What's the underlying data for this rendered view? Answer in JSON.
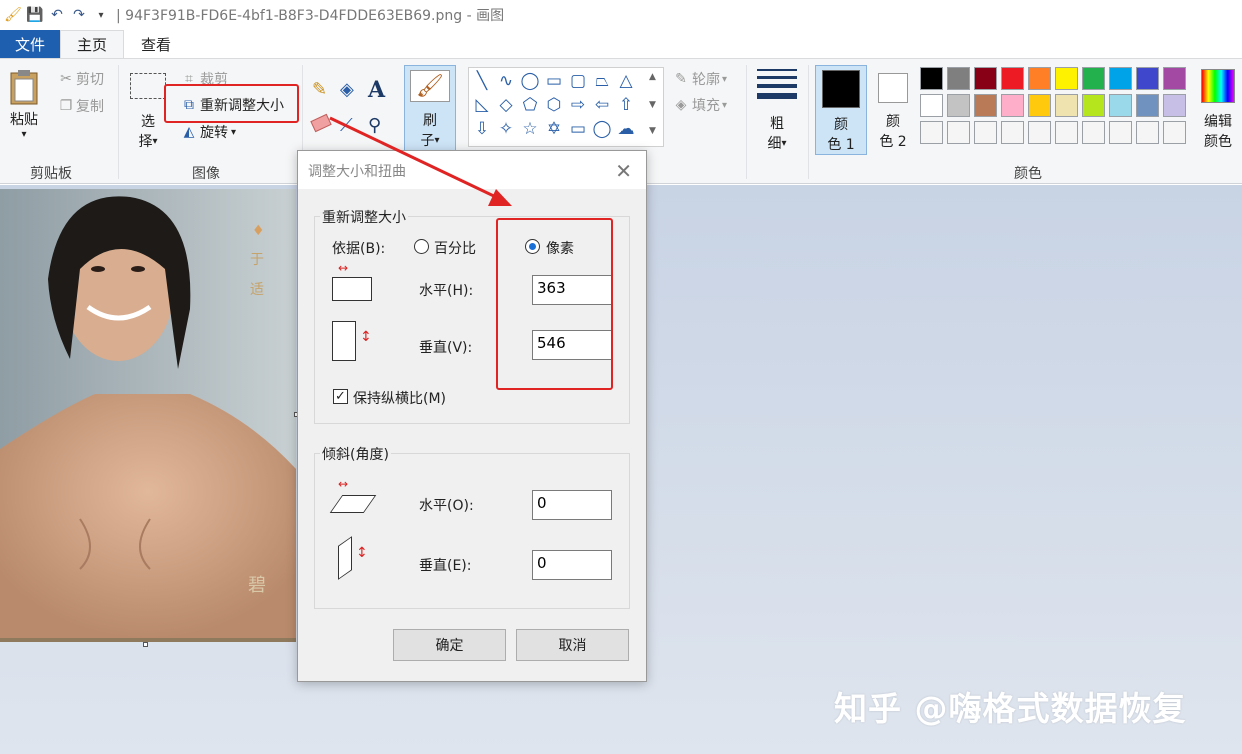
{
  "titlebar": {
    "title": "| 94F3F91B-FD6E-4bf1-B8F3-D4FDDE63EB69.png - 画图",
    "icons": [
      "paint-app-icon",
      "save-icon",
      "undo-icon",
      "redo-icon",
      "customize-dropdown-icon"
    ]
  },
  "tabs": {
    "file": "文件",
    "home": "主页",
    "view": "查看"
  },
  "ribbon": {
    "clipboard": {
      "paste": "粘贴",
      "cut": "剪切",
      "copy": "复制",
      "label": "剪贴板"
    },
    "image": {
      "select_1": "选",
      "select_2": "择",
      "crop": "裁剪",
      "resize": "重新调整大小",
      "rotate": "旋转",
      "label": "图像"
    },
    "tools": {
      "text_glyph": "A"
    },
    "brushes": {
      "label_1": "刷",
      "label_2": "子"
    },
    "shapes": {
      "outline": "轮廓",
      "fill": "填充"
    },
    "size": {
      "label_1": "粗",
      "label_2": "细"
    },
    "colors": {
      "color1_1": "颜",
      "color1_2": "色 1",
      "color2_1": "颜",
      "color2_2": "色 2",
      "edit_1": "编辑",
      "edit_2": "颜色",
      "label": "颜色",
      "row1": [
        "#000000",
        "#7f7f7f",
        "#880015",
        "#ed1c24",
        "#ff7f27",
        "#fff200",
        "#22b14c",
        "#00a2e8",
        "#3f48cc",
        "#a349a4"
      ],
      "row2": [
        "#ffffff",
        "#c3c3c3",
        "#b97a57",
        "#ffaec9",
        "#ffc90e",
        "#efe4b0",
        "#b5e61d",
        "#99d9ea",
        "#7092be",
        "#c8bfe7"
      ],
      "row3": [
        "#f5f5f5",
        "#f5f5f5",
        "#f5f5f5",
        "#f5f5f5",
        "#f5f5f5",
        "#f5f5f5",
        "#f5f5f5",
        "#f5f5f5",
        "#f5f5f5",
        "#f5f5f5"
      ]
    }
  },
  "photo": {
    "side_text_1": "于",
    "side_text_2": "适",
    "logo_text": "碧"
  },
  "dialog": {
    "title": "调整大小和扭曲",
    "resize_legend": "重新调整大小",
    "by_label": "依据(B):",
    "percent": "百分比",
    "pixels": "像素",
    "horizontal_label": "水平(H):",
    "horizontal_value": "363",
    "vertical_label": "垂直(V):",
    "vertical_value": "546",
    "keep_ratio": "保持纵横比(M)",
    "skew_legend": "倾斜(角度)",
    "skew_h_label": "水平(O):",
    "skew_h_value": "0",
    "skew_v_label": "垂直(E):",
    "skew_v_value": "0",
    "ok": "确定",
    "cancel": "取消"
  },
  "watermark": "知乎 @嗨格式数据恢复"
}
